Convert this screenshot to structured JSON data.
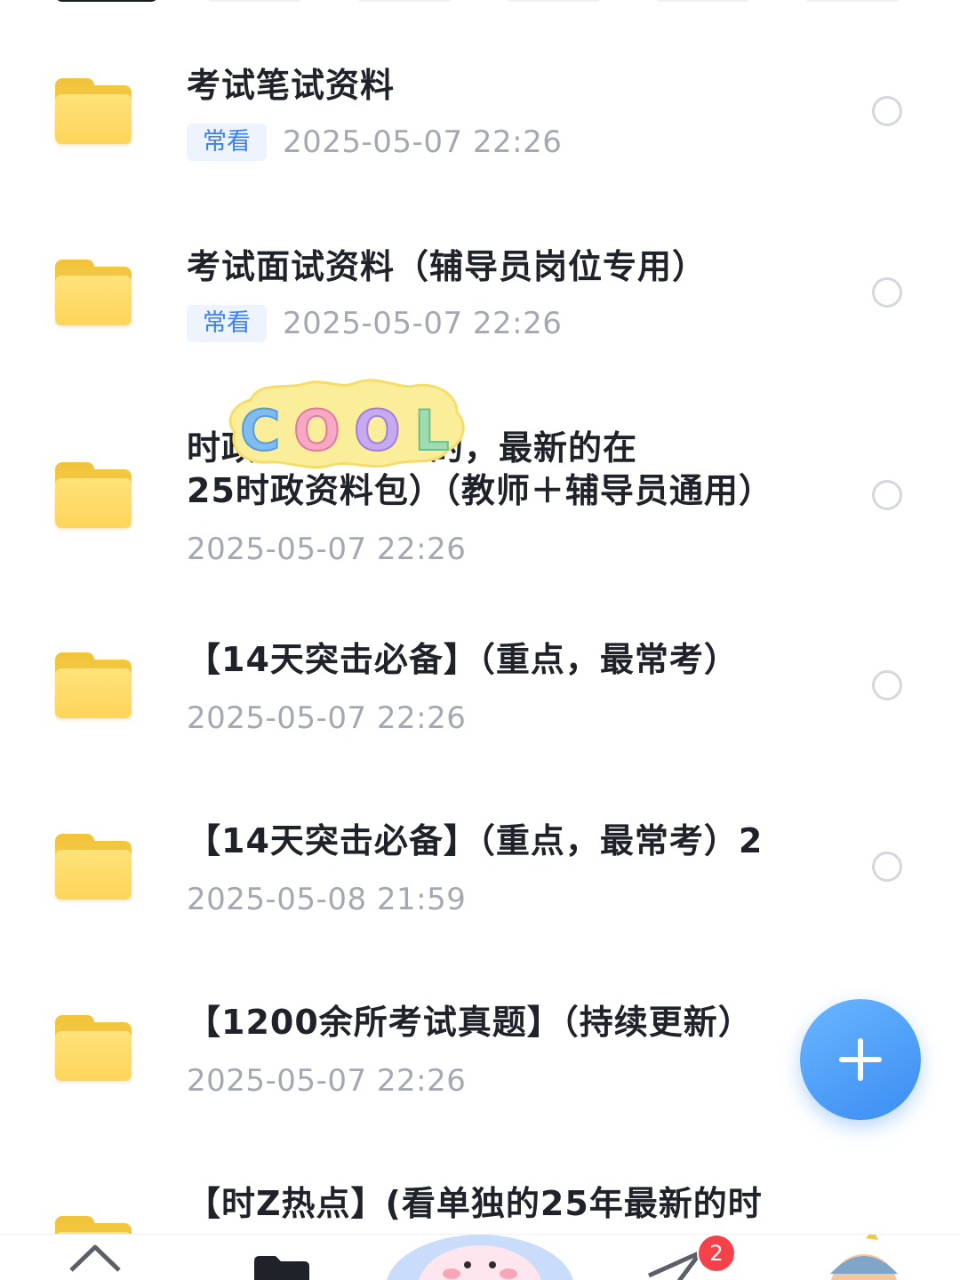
{
  "folders": [
    {
      "title": "考试笔试资料",
      "badge": "常看",
      "date": "2025-05-07  22:26"
    },
    {
      "title": "考试面试资料（辅导员岗位专用）",
      "badge": "常看",
      "date": "2025-05-07  22:26"
    },
    {
      "title_line1": "时政（最有价值的，最新的在",
      "title_line2": "25时政资料包）（教师＋辅导员通用）",
      "date": "2025-05-07  22:26"
    },
    {
      "title": "【14天突击必备】（重点，最常考）",
      "date": "2025-05-07  22:26"
    },
    {
      "title": "【14天突击必备】（重点，最常考）2",
      "date": "2025-05-08  21:59"
    },
    {
      "title": "【1200余所考试真题】（持续更新）",
      "date": "2025-05-07  22:26"
    },
    {
      "title": "【时Z热点】(看单独的25年最新的时"
    }
  ],
  "sticker_text": "COOL",
  "fab_icon": "plus-icon",
  "bottom_nav": {
    "items": [
      "home-icon",
      "files-icon",
      "avatar-center-icon",
      "send-icon",
      "profile-avatar-icon"
    ],
    "send_badge_count": "2"
  },
  "colors": {
    "accent": "#3d7ef5",
    "folder": "#fdd55a",
    "badge_bg": "#eef4fd",
    "date_gray": "#a4a8b0",
    "title": "#1f2329",
    "fab": "#3a8df3",
    "nav_badge": "#f5424a"
  }
}
